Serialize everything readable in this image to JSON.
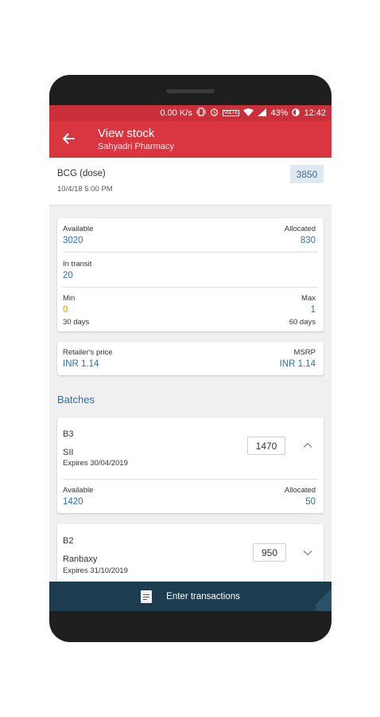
{
  "status_bar": {
    "speed": "0.00 K/s",
    "volte_badge": "VoLTE",
    "battery": "43%",
    "time": "12:42",
    "icons": [
      "vibrate-icon",
      "alarm-icon",
      "wifi-icon",
      "signal-icon",
      "battery-icon"
    ]
  },
  "toolbar": {
    "title": "View stock",
    "subtitle": "Sahyadri Pharmacy",
    "back_icon": "arrow-left-icon"
  },
  "item": {
    "name": "BCG (dose)",
    "date": "10/4/18 5:00 PM",
    "quantity": "3850"
  },
  "stock": {
    "available_label": "Available",
    "available_value": "3020",
    "allocated_label": "Allocated",
    "allocated_value": "830",
    "in_transit_label": "In transit",
    "in_transit_value": "20",
    "min_label": "Min",
    "min_value": "0",
    "min_days": "30 days",
    "max_label": "Max",
    "max_value": "1",
    "max_days": "60 days"
  },
  "price": {
    "retailer_label": "Retailer's price",
    "retailer_value": "INR 1.14",
    "msrp_label": "MSRP",
    "msrp_value": "INR 1.14"
  },
  "batches_heading": "Batches",
  "batches": [
    {
      "id": "B3",
      "manufacturer": "SII",
      "expiry": "Expires 30/04/2019",
      "quantity": "1470",
      "expanded": true,
      "available_label": "Available",
      "available_value": "1420",
      "allocated_label": "Allocated",
      "allocated_value": "50"
    },
    {
      "id": "B2",
      "manufacturer": "Ranbaxy",
      "expiry": "Expires 31/10/2019",
      "quantity": "950",
      "expanded": false
    }
  ],
  "bottom_bar": {
    "label": "Enter transactions",
    "icon": "document-icon"
  },
  "colors": {
    "toolbar": "#d93640",
    "status_bar": "#c9303a",
    "accent_blue": "#2c6eb4",
    "min_orange": "#e69a00",
    "bottom_bar": "#1c3c4f"
  }
}
